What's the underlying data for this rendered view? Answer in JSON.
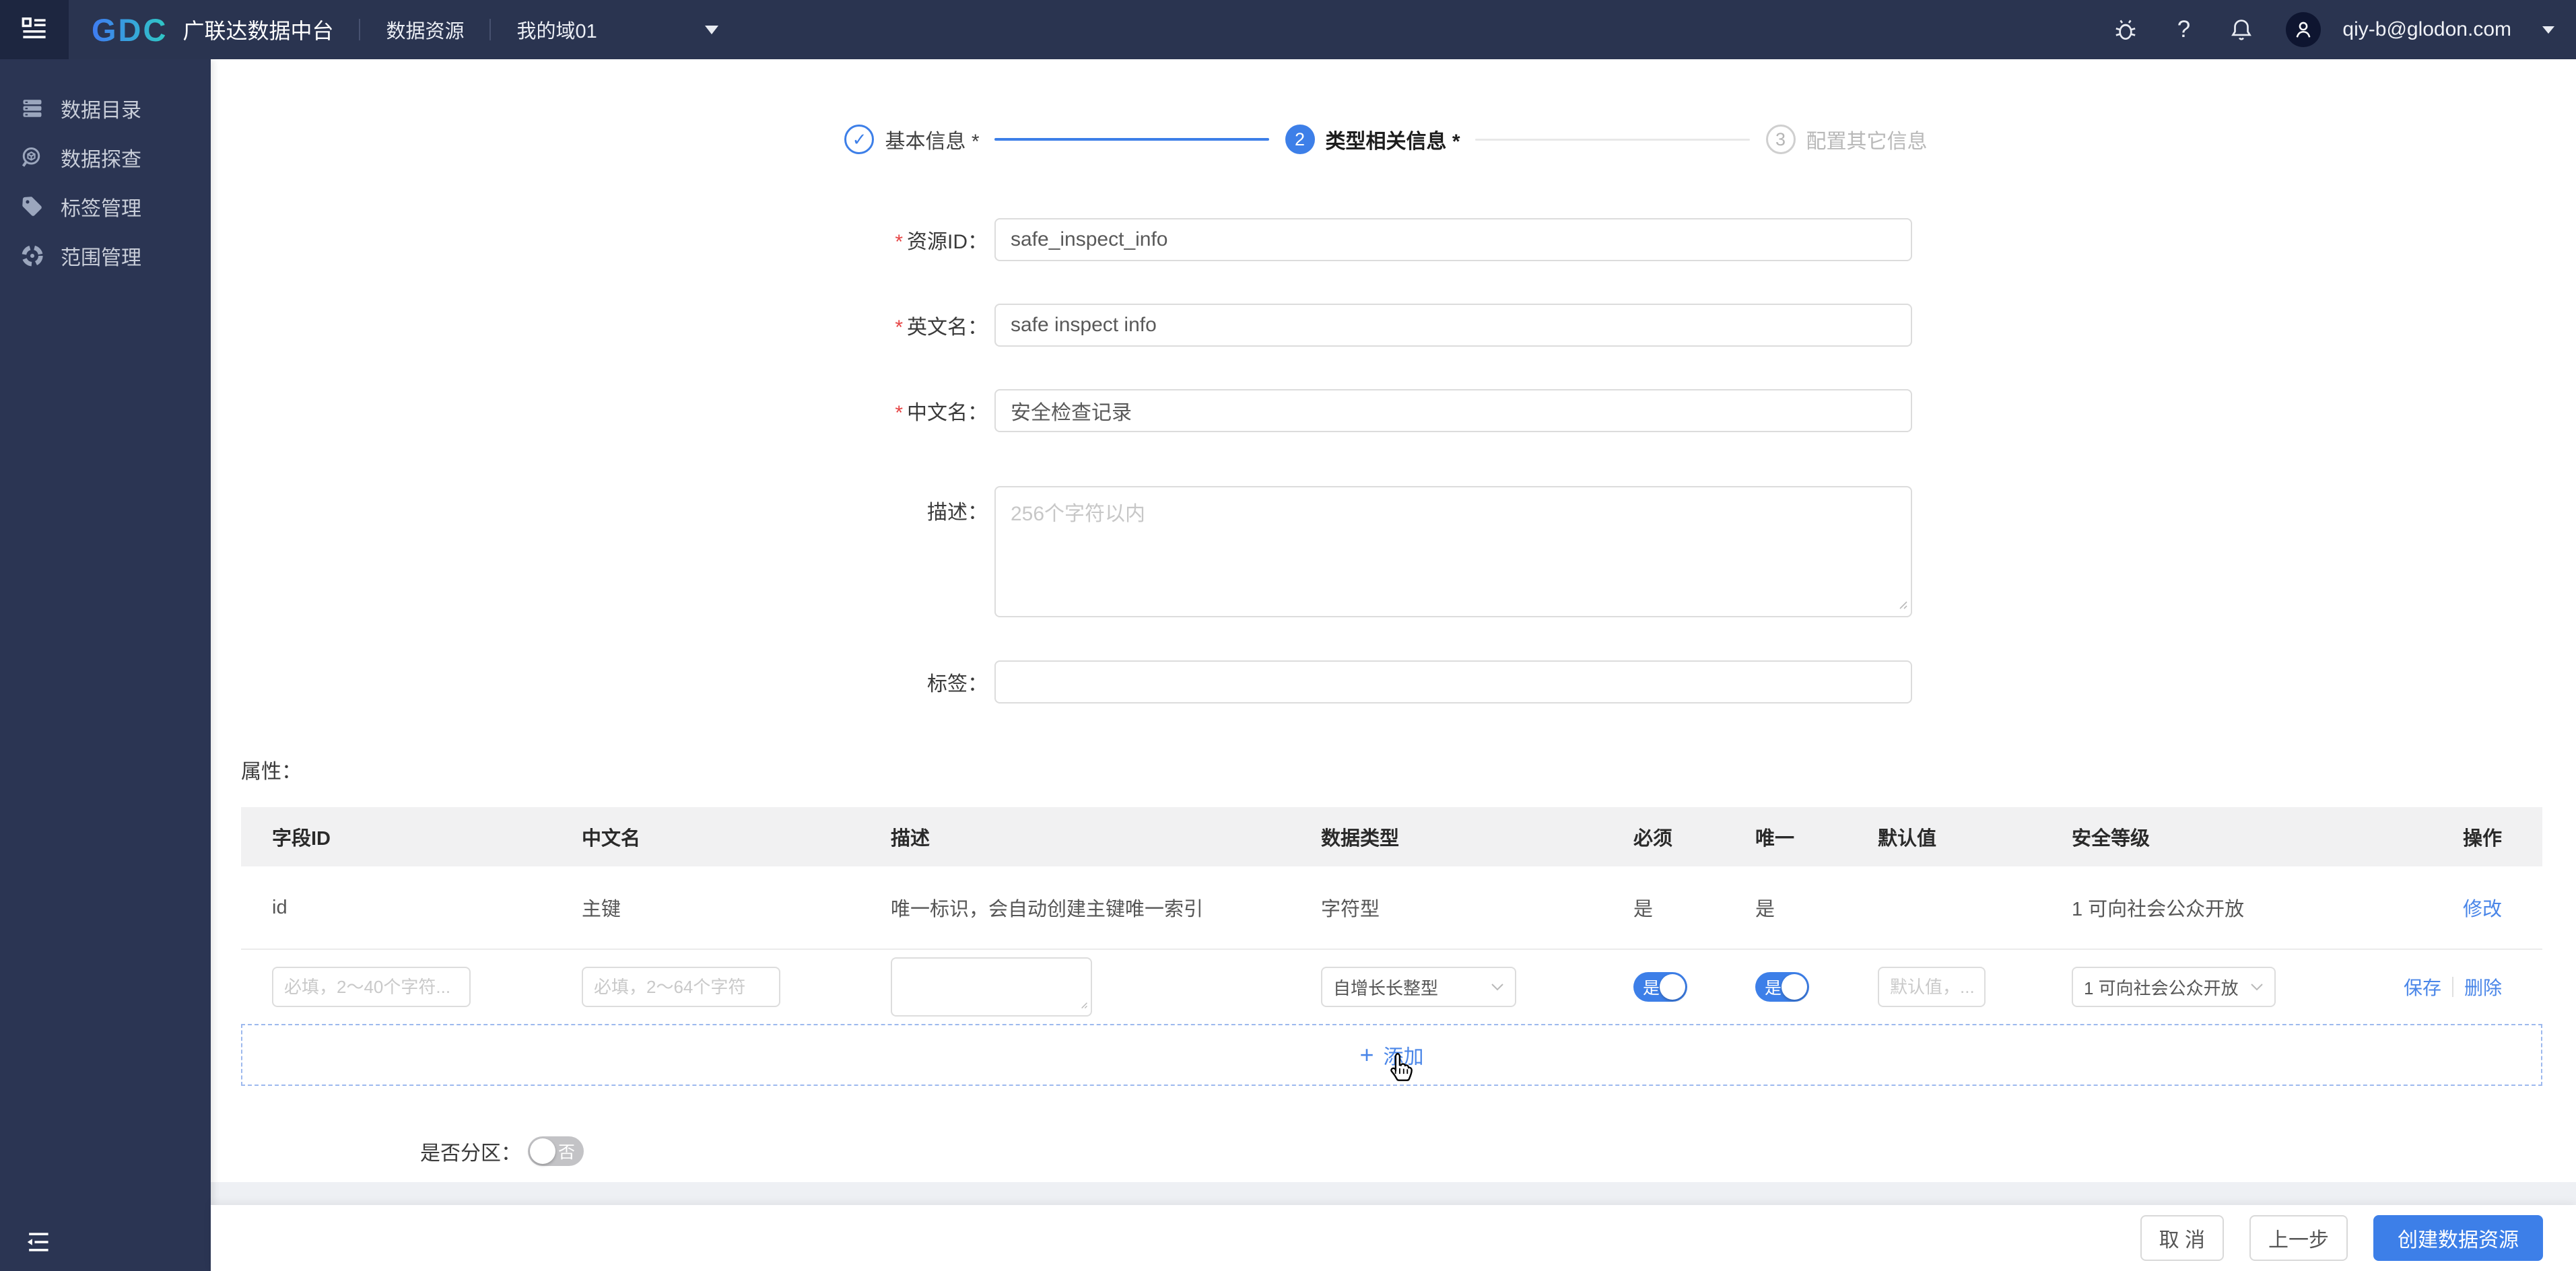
{
  "topbar": {
    "logo": "GDC",
    "product": "广联达数据中台",
    "nav_item": "数据资源",
    "domain": "我的域01",
    "help_glyph": "?",
    "email": "qiy-b@glodon.com"
  },
  "sidebar": {
    "items": [
      "数据目录",
      "数据探查",
      "标签管理",
      "范围管理"
    ]
  },
  "stepper": {
    "steps": [
      {
        "label": "基本信息 *",
        "glyph": "✓"
      },
      {
        "label": "类型相关信息 *",
        "num": "2"
      },
      {
        "label": "配置其它信息",
        "num": "3"
      }
    ]
  },
  "form": {
    "asterisk": "*",
    "resource_id": {
      "label": "资源ID：",
      "value": "safe_inspect_info"
    },
    "en_name": {
      "label": "英文名：",
      "value": "safe inspect info"
    },
    "cn_name": {
      "label": "中文名：",
      "value": "安全检查记录"
    },
    "desc": {
      "label": "描述：",
      "placeholder": "256个字符以内"
    },
    "tag": {
      "label": "标签："
    }
  },
  "attrs": {
    "section_label": "属性：",
    "headers": [
      "字段ID",
      "中文名",
      "描述",
      "数据类型",
      "必须",
      "唯一",
      "默认值",
      "安全等级",
      "操作"
    ],
    "row": {
      "field_id": "id",
      "cn_name": "主键",
      "desc": "唯一标识，会自动创建主键唯一索引",
      "data_type": "字符型",
      "required": "是",
      "unique": "是",
      "default_value": "",
      "security_level": "1 可向社会公众开放",
      "action": "修改"
    },
    "editor": {
      "field_id_placeholder": "必填，2～40个字符...",
      "cn_name_placeholder": "必填，2～64个字符",
      "data_type": "自增长长整型",
      "required_toggle": "是",
      "unique_toggle": "是",
      "default_placeholder": "默认值，...",
      "security_level": "1 可向社会公众开放",
      "save": "保存",
      "delete": "删除"
    },
    "add": {
      "plus": "+",
      "label": "添加"
    }
  },
  "partition": {
    "label": "是否分区：",
    "toggle": "否"
  },
  "footer": {
    "cancel": "取 消",
    "prev": "上一步",
    "create": "创建数据资源"
  },
  "colors": {
    "accent": "#3d7fe8",
    "link": "#4a86e8",
    "topbar_bg": "#2a3450",
    "topbar_corner_bg": "#1d2640",
    "sidebar_bg": "#2b3553",
    "table_header_bg": "#f1f1f2",
    "danger": "#e64545"
  }
}
